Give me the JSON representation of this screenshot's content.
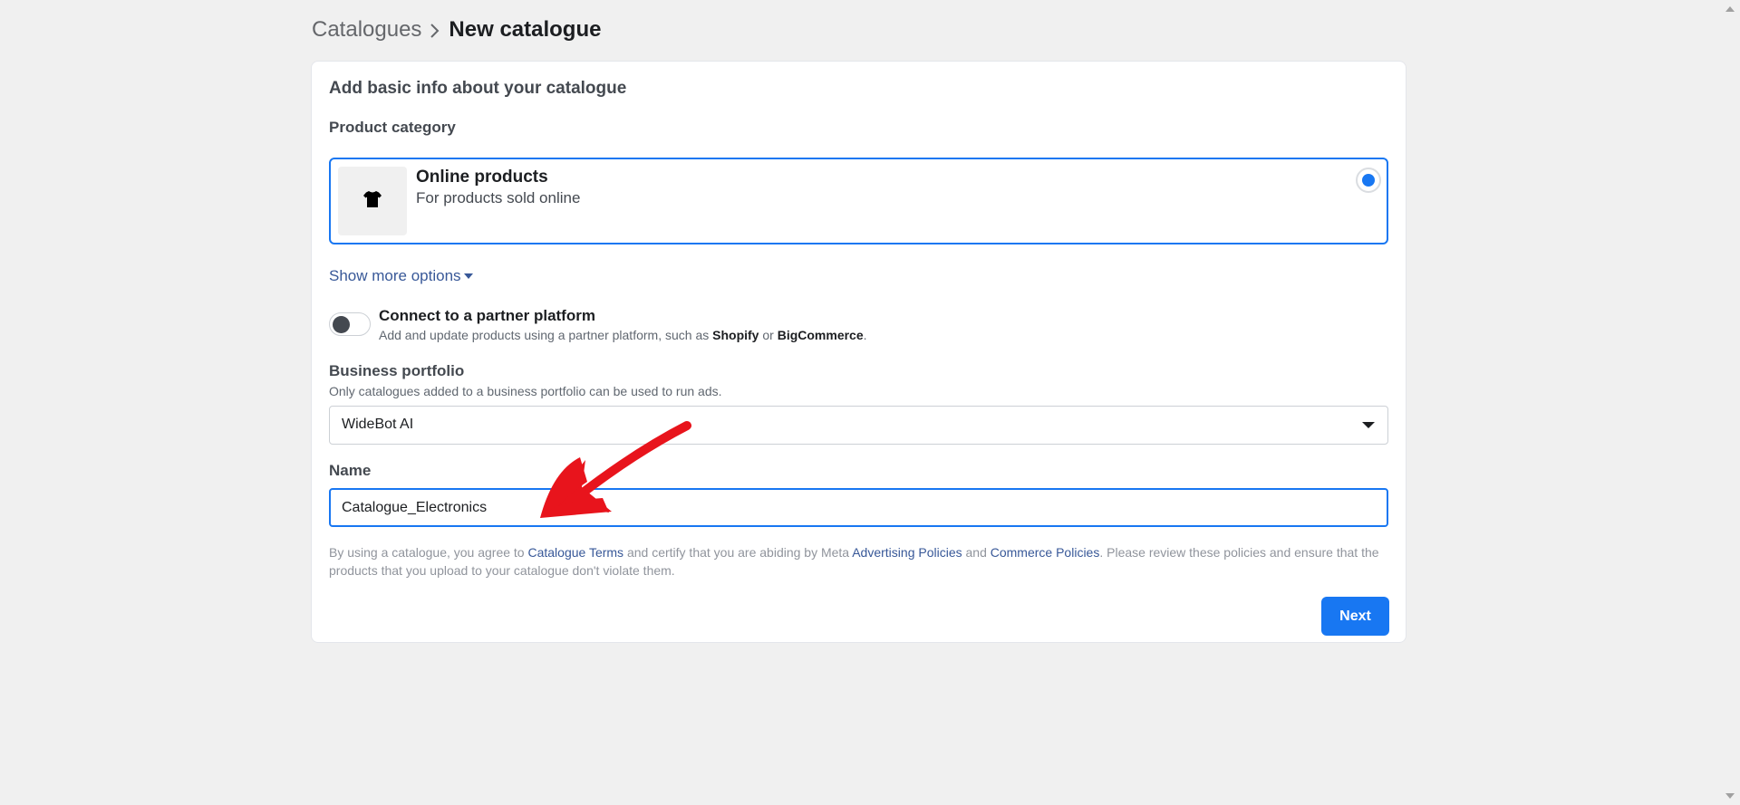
{
  "breadcrumb": {
    "root": "Catalogues",
    "current": "New catalogue"
  },
  "form": {
    "title": "Add basic info about your catalogue",
    "product_category_label": "Product category",
    "option": {
      "icon": "tshirt-icon",
      "title": "Online products",
      "subtitle": "For products sold online",
      "selected": true
    },
    "show_more": "Show more options",
    "partner": {
      "title": "Connect to a partner platform",
      "desc_prefix": "Add and update products using a partner platform, such as ",
      "shopify": "Shopify",
      "or": " or ",
      "bigcommerce": "BigCommerce",
      "period": ".",
      "enabled": false
    },
    "business_portfolio": {
      "label": "Business portfolio",
      "helper": "Only catalogues added to a business portfolio can be used to run ads.",
      "value": "WideBot AI"
    },
    "name": {
      "label": "Name",
      "value": "Catalogue_Electronics"
    },
    "terms": {
      "t1": "By using a catalogue, you agree to ",
      "link1": "Catalogue Terms",
      "t2": " and certify that you are abiding by Meta ",
      "link2": "Advertising Policies",
      "t3": " and ",
      "link3": "Commerce Policies",
      "t4": ". Please review these policies and ensure that the products that you upload to your catalogue don't violate them."
    },
    "next_label": "Next"
  },
  "colors": {
    "accent": "#1877f2",
    "link": "#385898",
    "annotation": "#e8141c"
  }
}
